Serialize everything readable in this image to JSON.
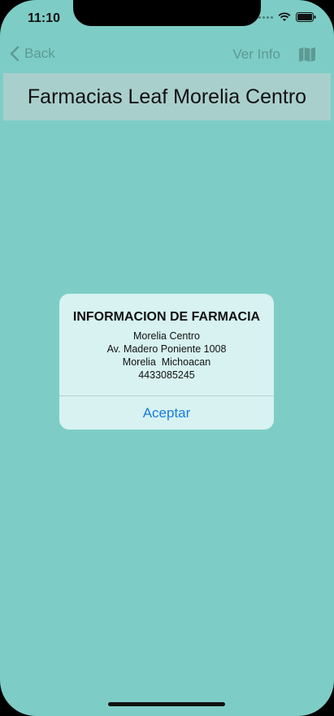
{
  "status": {
    "time": "11:10"
  },
  "nav": {
    "back_label": "Back",
    "info_label": "Ver Info"
  },
  "header": {
    "title": "Farmacias Leaf Morelia Centro"
  },
  "alert": {
    "title": "INFORMACION DE FARMACIA",
    "line1": "Morelia Centro",
    "line2": "Av. Madero Poniente 1008",
    "line3": "Morelia  Michoacan",
    "line4": "4433085245",
    "button_label": "Aceptar"
  },
  "colors": {
    "background": "#7dcdc6",
    "accent": "#1a7be0",
    "title_bar": "#a9cfcd"
  },
  "icons": [
    "chevron-left-icon",
    "map-icon",
    "wifi-icon",
    "battery-icon",
    "signal-dots-icon"
  ]
}
